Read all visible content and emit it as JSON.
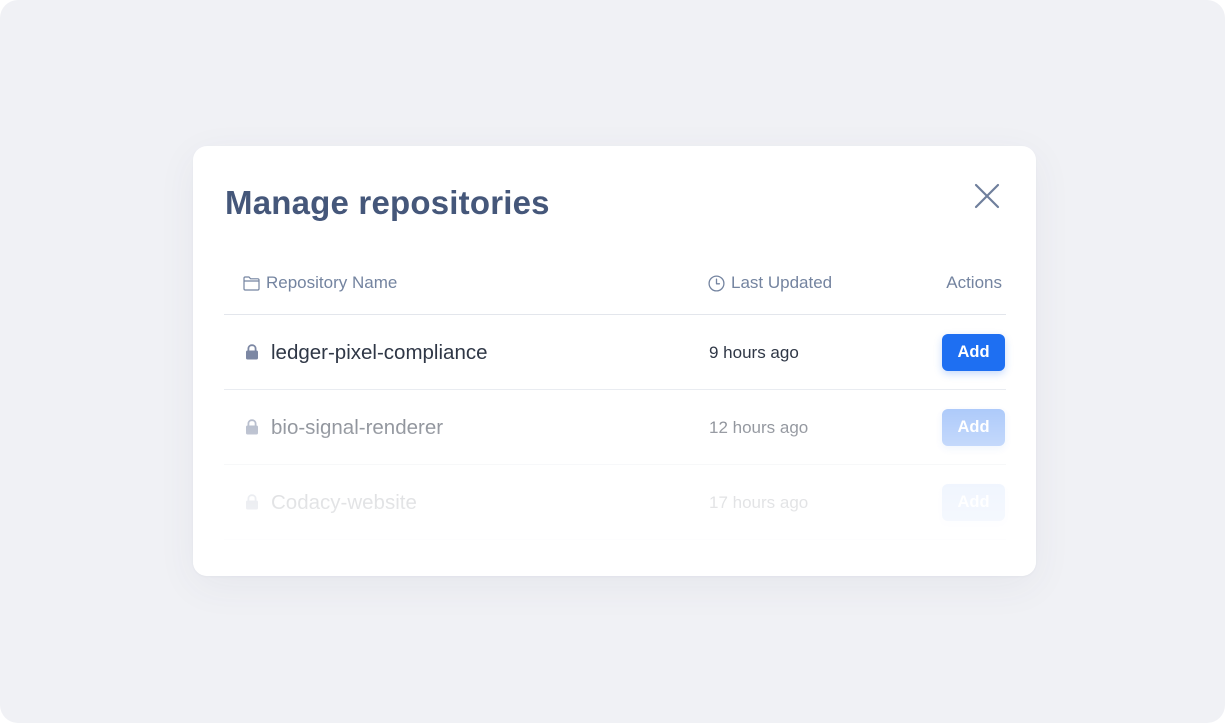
{
  "modal": {
    "title": "Manage repositories",
    "close_icon": "close-icon"
  },
  "table": {
    "columns": {
      "name": {
        "label": "Repository Name",
        "icon": "folder-icon"
      },
      "updated": {
        "label": "Last Updated",
        "icon": "clock-icon"
      },
      "actions": {
        "label": "Actions"
      }
    },
    "rows": [
      {
        "name": "ledger-pixel-compliance",
        "updated": "9 hours ago",
        "action": "Add",
        "icon": "lock-icon"
      },
      {
        "name": "bio-signal-renderer",
        "updated": "12 hours ago",
        "action": "Add",
        "icon": "lock-icon"
      },
      {
        "name": "Codacy-website",
        "updated": "17 hours ago",
        "action": "Add",
        "icon": "lock-icon"
      }
    ]
  },
  "colors": {
    "page_background": "#f0f1f5",
    "title": "#45577a",
    "primary_button": "#1e6ff2",
    "header_text": "#7484a0",
    "lock_icon": "#7c87a3"
  }
}
